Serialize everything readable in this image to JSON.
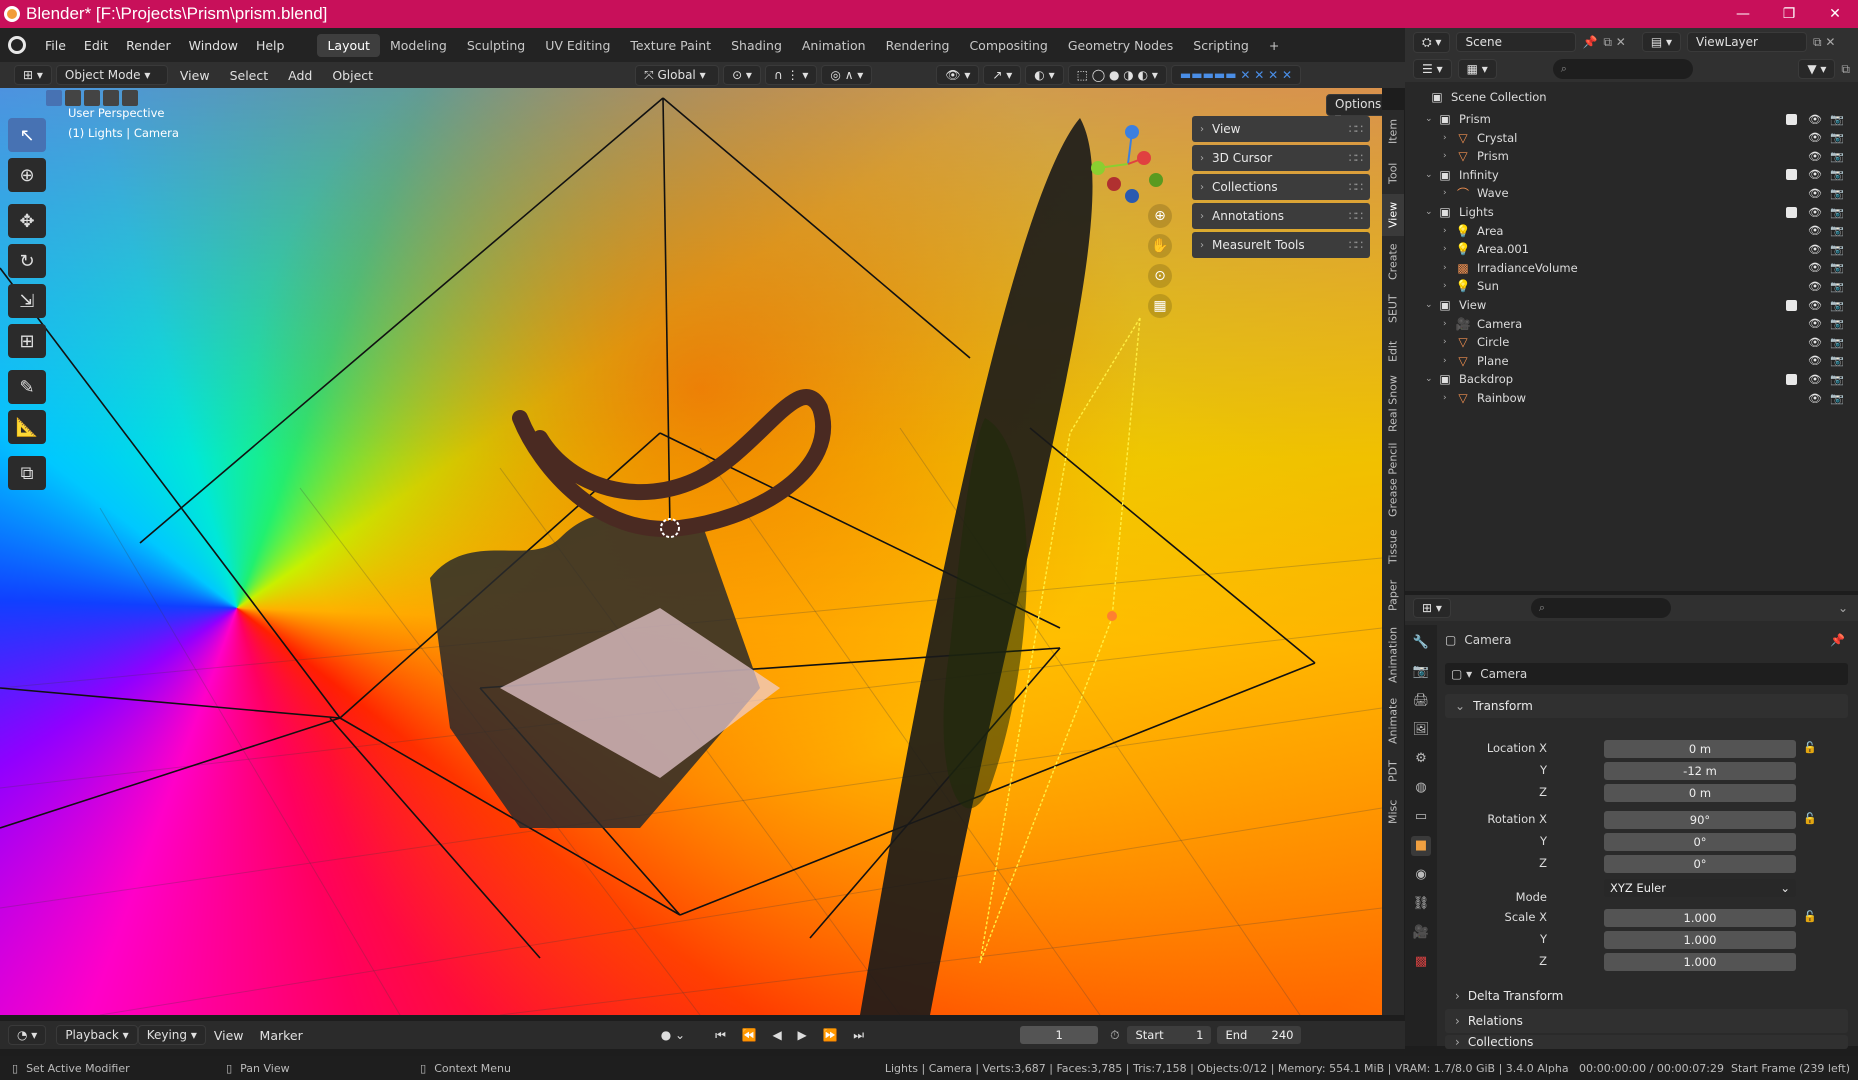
{
  "window": {
    "title": "Blender* [F:\\Projects\\Prism\\prism.blend]",
    "min": "—",
    "max": "❐",
    "close": "✕"
  },
  "menu": {
    "items": [
      "File",
      "Edit",
      "Render",
      "Window",
      "Help"
    ],
    "workspaces": [
      "Layout",
      "Modeling",
      "Sculpting",
      "UV Editing",
      "Texture Paint",
      "Shading",
      "Animation",
      "Rendering",
      "Compositing",
      "Geometry Nodes",
      "Scripting"
    ],
    "active_workspace": "Layout",
    "add": "+"
  },
  "scene": {
    "label": "Scene",
    "viewlayer": "ViewLayer"
  },
  "header": {
    "mode": "Object Mode",
    "menus": [
      "View",
      "Select",
      "Add",
      "Object"
    ],
    "orientation": "Global",
    "options": "Options"
  },
  "viewport": {
    "perspective": "User Perspective",
    "context": "(1) Lights | Camera"
  },
  "npanel": {
    "items": [
      "View",
      "3D Cursor",
      "Collections",
      "Annotations",
      "MeasureIt Tools"
    ]
  },
  "sidetabs": [
    "Item",
    "Tool",
    "View",
    "Create",
    "SEUT",
    "Edit",
    "Real Snow",
    "Grease Pencil",
    "Tissue",
    "Paper",
    "Animation",
    "Animate",
    "PDT",
    "Misc"
  ],
  "outliner": {
    "root": "Scene Collection",
    "rows": [
      {
        "name": "Prism",
        "icon": "collection-icon",
        "level": 1,
        "check": true
      },
      {
        "name": "Crystal",
        "icon": "mesh-icon",
        "level": 2
      },
      {
        "name": "Prism",
        "icon": "mesh-icon",
        "level": 2
      },
      {
        "name": "Infinity",
        "icon": "collection-icon",
        "level": 1,
        "check": true
      },
      {
        "name": "Wave",
        "icon": "curve-icon",
        "level": 2
      },
      {
        "name": "Lights",
        "icon": "collection-icon",
        "level": 1,
        "check": true
      },
      {
        "name": "Area",
        "icon": "light-icon",
        "level": 2
      },
      {
        "name": "Area.001",
        "icon": "light-icon",
        "level": 2
      },
      {
        "name": "IrradianceVolume",
        "icon": "probe-icon",
        "level": 2
      },
      {
        "name": "Sun",
        "icon": "light-icon",
        "level": 2
      },
      {
        "name": "View",
        "icon": "collection-icon",
        "level": 1,
        "check": true
      },
      {
        "name": "Camera",
        "icon": "camera-icon",
        "level": 2
      },
      {
        "name": "Circle",
        "icon": "mesh-icon",
        "level": 2
      },
      {
        "name": "Plane",
        "icon": "mesh-icon",
        "level": 2
      },
      {
        "name": "Backdrop",
        "icon": "collection-icon",
        "level": 1,
        "check": true
      },
      {
        "name": "Rainbow",
        "icon": "mesh-icon",
        "level": 2
      }
    ]
  },
  "properties": {
    "object": "Camera",
    "datablock": "Camera",
    "transform": "Transform",
    "location_label": "Location X",
    "location": [
      "0 m",
      "-12 m",
      "0 m"
    ],
    "rotation_label": "Rotation X",
    "rotation": [
      "90°",
      "0°",
      "0°"
    ],
    "mode_label": "Mode",
    "mode": "XYZ Euler",
    "scale_label": "Scale X",
    "scale": [
      "1.000",
      "1.000",
      "1.000"
    ],
    "y": "Y",
    "z": "Z",
    "delta": "Delta Transform",
    "relations": "Relations",
    "collections": "Collections"
  },
  "timeline": {
    "menus": [
      "Playback",
      "Keying",
      "View",
      "Marker"
    ],
    "current": "1",
    "start_label": "Start",
    "start": "1",
    "end_label": "End",
    "end": "240"
  },
  "status": {
    "left1": "Set Active Modifier",
    "left2": "Pan View",
    "left3": "Context Menu",
    "right": "Lights | Camera | Verts:3,687 | Faces:3,785 | Tris:7,158 | Objects:0/12 | Memory: 554.1 MiB | VRAM: 1.7/8.0 GiB | 3.4.0 Alpha   00:00:00:00 / 00:00:07:29  Start Frame (239 left)"
  }
}
